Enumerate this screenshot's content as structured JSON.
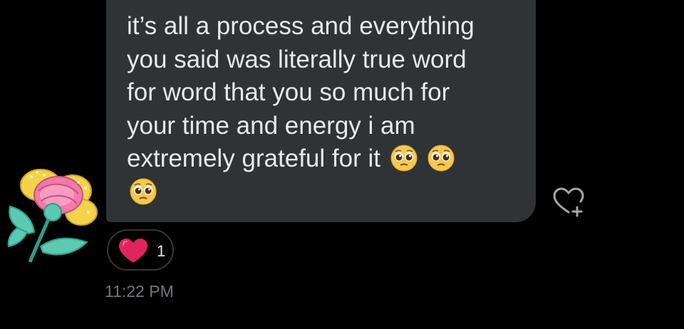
{
  "message": {
    "text": "it’s all a process and everything\nyou said was literally true word\nfor word that you so much for\nyour time and energy i am\nextremely grateful for it",
    "emojis": [
      "pleading-face",
      "pleading-face",
      "pleading-face"
    ]
  },
  "reaction": {
    "emoji": "heart",
    "count": "1"
  },
  "timestamp": "11:22 PM",
  "add_reaction_icon": "heart-plus-icon",
  "colors": {
    "background": "#000000",
    "bubble": "#2f3336",
    "text": "#e7e9ea",
    "timestamp": "#71767b",
    "heart": "#e0245e"
  }
}
